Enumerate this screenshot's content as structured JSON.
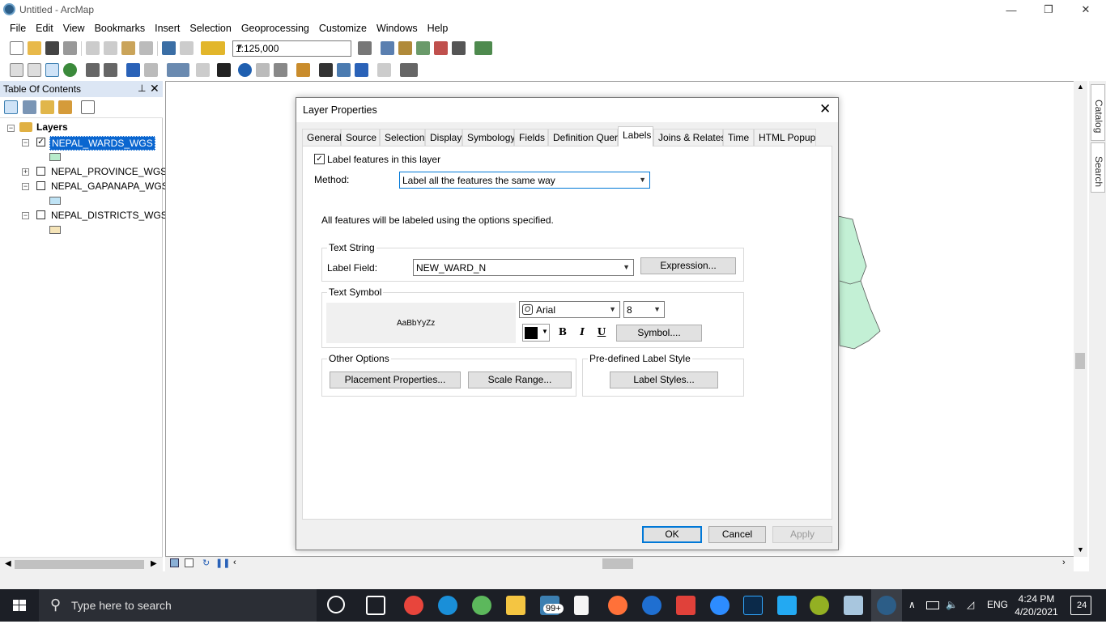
{
  "window": {
    "title": "Untitled - ArcMap",
    "minimize_glyph": "—",
    "restore_glyph": "❐",
    "close_glyph": "✕"
  },
  "menu": [
    "File",
    "Edit",
    "View",
    "Bookmarks",
    "Insert",
    "Selection",
    "Geoprocessing",
    "Customize",
    "Windows",
    "Help"
  ],
  "toolbar": {
    "scale": "1:125,000"
  },
  "toc": {
    "title": "Table Of Contents",
    "pin_glyph": "⊥",
    "close_glyph": "✕",
    "root_label": "Layers",
    "layers": [
      {
        "name": "NEPAL_WARDS_WGS",
        "checked": true,
        "expanded": true,
        "swatch": "#b8eccb",
        "selected": true
      },
      {
        "name": "NEPAL_PROVINCE_WGS",
        "checked": false,
        "expanded": false,
        "swatch": null,
        "selected": false
      },
      {
        "name": "NEPAL_GAPANAPA_WGS",
        "checked": false,
        "expanded": true,
        "swatch": "#bfe3f5",
        "selected": false
      },
      {
        "name": "NEPAL_DISTRICTS_WGS",
        "checked": false,
        "expanded": true,
        "swatch": "#f5e4b8",
        "selected": false
      }
    ]
  },
  "side_tabs": {
    "catalog": "Catalog",
    "search": "Search"
  },
  "dialog": {
    "title": "Layer Properties",
    "tabs": [
      "General",
      "Source",
      "Selection",
      "Display",
      "Symbology",
      "Fields",
      "Definition Query",
      "Labels",
      "Joins & Relates",
      "Time",
      "HTML Popup"
    ],
    "active_tab": "Labels",
    "label_features_text": "Label features in this layer",
    "label_features_checked": true,
    "method_label": "Method:",
    "method_value": "Label all the features the same way",
    "info_text": "All features will be labeled using the options specified.",
    "text_string": {
      "legend": "Text String",
      "field_label": "Label Field:",
      "field_value": "NEW_WARD_N",
      "expression_btn": "Expression..."
    },
    "text_symbol": {
      "legend": "Text Symbol",
      "preview": "AaBbYyZz",
      "font": "Arial",
      "size": "8",
      "bold": "B",
      "italic": "I",
      "underline": "U",
      "symbol_btn": "Symbol...."
    },
    "other_options": {
      "legend": "Other Options",
      "placement_btn": "Placement Properties...",
      "scale_btn": "Scale Range..."
    },
    "predefined": {
      "legend": "Pre-defined Label Style",
      "styles_btn": "Label Styles..."
    },
    "buttons": {
      "ok": "OK",
      "cancel": "Cancel",
      "apply": "Apply"
    }
  },
  "taskbar": {
    "search_placeholder": "Type here to search",
    "badge": "99+",
    "language": "ENG",
    "time": "4:24 PM",
    "date": "4/20/2021",
    "notification_count": "24"
  },
  "colors": {
    "selection": "#0a66d0",
    "polygon_fill": "#c3f0d5",
    "taskbar": "#1c1f26",
    "accent": "#0078d7"
  }
}
